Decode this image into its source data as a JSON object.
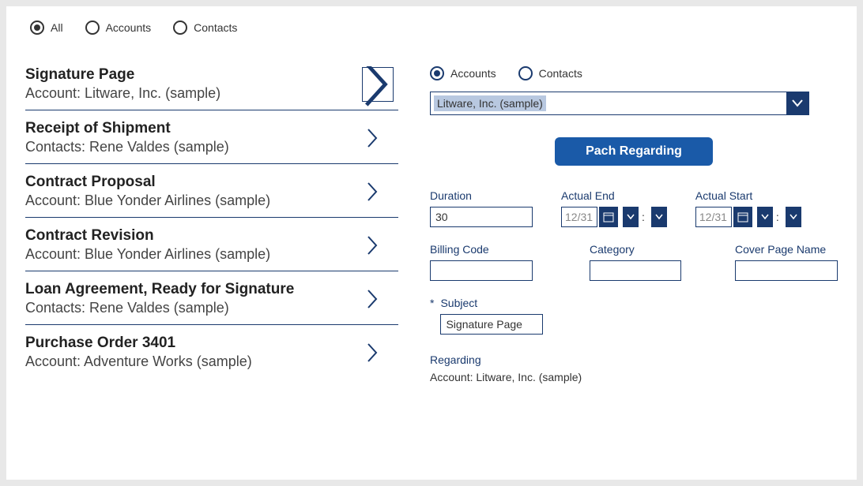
{
  "topFilter": {
    "options": [
      "All",
      "Accounts",
      "Contacts"
    ],
    "selected": "All"
  },
  "list": [
    {
      "title": "Signature Page",
      "sub": "Account: Litware, Inc. (sample)",
      "boxed": true
    },
    {
      "title": "Receipt of Shipment",
      "sub": "Contacts: Rene Valdes (sample)"
    },
    {
      "title": "Contract Proposal",
      "sub": "Account: Blue Yonder Airlines (sample)"
    },
    {
      "title": "Contract Revision",
      "sub": "Account: Blue Yonder Airlines (sample)"
    },
    {
      "title": "Loan Agreement, Ready for Signature",
      "sub": "Contacts: Rene Valdes (sample)"
    },
    {
      "title": "Purchase Order 3401",
      "sub": "Account: Adventure Works (sample)"
    }
  ],
  "detailFilter": {
    "options": [
      "Accounts",
      "Contacts"
    ],
    "selected": "Accounts"
  },
  "combo": {
    "value": "Litware, Inc. (sample)"
  },
  "patchButton": "Pach Regarding",
  "fields": {
    "duration": {
      "label": "Duration",
      "value": "30"
    },
    "actualEnd": {
      "label": "Actual End",
      "value": "12/31"
    },
    "actualStart": {
      "label": "Actual Start",
      "value": "12/31"
    },
    "billingCode": {
      "label": "Billing Code",
      "value": ""
    },
    "category": {
      "label": "Category",
      "value": ""
    },
    "coverPageName": {
      "label": "Cover Page Name",
      "value": ""
    },
    "subject": {
      "label": "Subject",
      "value": "Signature Page"
    },
    "regarding": {
      "label": "Regarding",
      "value": "Account: Litware, Inc. (sample)"
    }
  }
}
